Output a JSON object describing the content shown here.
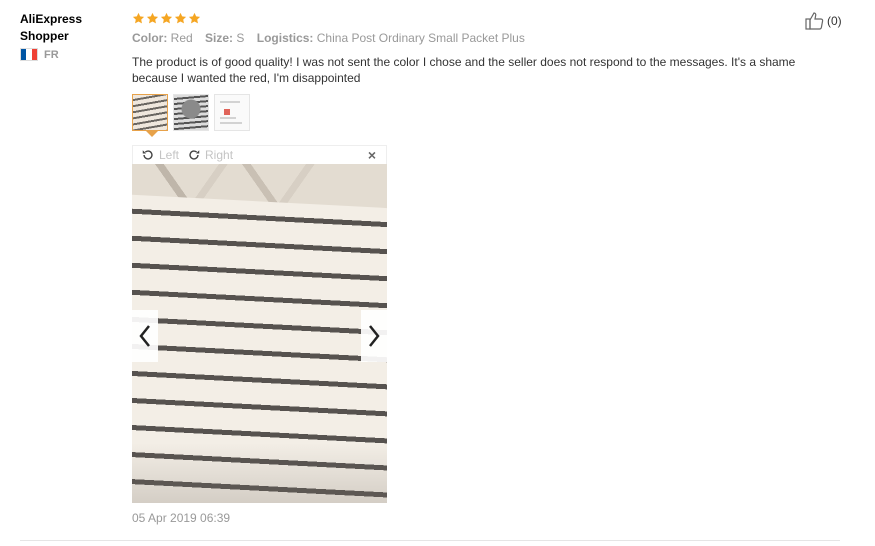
{
  "reviewer": {
    "name": "AliExpress Shopper",
    "country_code": "FR",
    "flag_colors": [
      "#0055A4",
      "#FFFFFF",
      "#EF4135"
    ]
  },
  "review": {
    "rating": 5,
    "star_color": "#f5a623",
    "attributes": [
      {
        "key": "Color:",
        "value": "Red"
      },
      {
        "key": "Size:",
        "value": "S"
      },
      {
        "key": "Logistics:",
        "value": "China Post Ordinary Small Packet Plus"
      }
    ],
    "text": "The product is of good quality! I was not sent the color I chose and the seller does not respond to the messages. It's a shame because I wanted the red, I'm disappointed",
    "date": "05 Apr 2019 06:39"
  },
  "helpful": {
    "icon": "thumbs-up-icon",
    "count": "(0)"
  },
  "viewer": {
    "rotate_left_label": "Left",
    "rotate_right_label": "Right",
    "close_label": "×"
  },
  "colors": {
    "active_thumb_border": "#e7a24a",
    "muted_text": "#999999"
  }
}
